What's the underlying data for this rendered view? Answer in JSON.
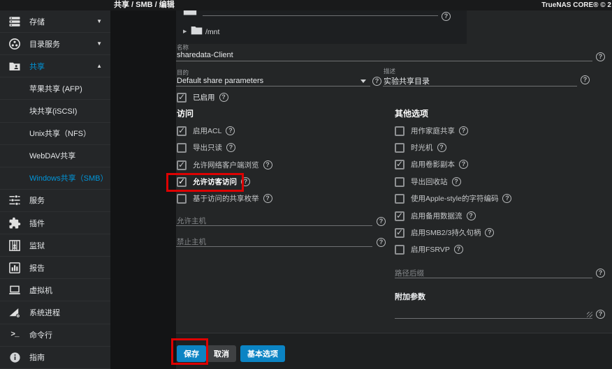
{
  "topbar": {
    "breadcrumb": "共享 / SMB / 编辑",
    "brand": "TrueNAS CORE® © 2"
  },
  "icons": {
    "check": "✓",
    "help": "?",
    "chevron_down": "▼",
    "chevron_up": "▲",
    "tree_collapsed": "▶"
  },
  "sidebar": {
    "items": [
      {
        "label": "存储",
        "icon": "storage-icon",
        "expander": "down"
      },
      {
        "label": "目录服务",
        "icon": "directory-services-icon",
        "expander": "down"
      },
      {
        "label": "共享",
        "icon": "folder-shared-icon",
        "expander": "up",
        "active": true
      },
      {
        "label": "苹果共享 (AFP)",
        "sub": true
      },
      {
        "label": "块共享(iSCSI)",
        "sub": true
      },
      {
        "label": "Unix共享（NFS）",
        "sub": true
      },
      {
        "label": "WebDAV共享",
        "sub": true
      },
      {
        "label": "Windows共享（SMB）",
        "sub": true,
        "active": true
      },
      {
        "label": "服务",
        "icon": "services-icon"
      },
      {
        "label": "插件",
        "icon": "plugins-icon"
      },
      {
        "label": "监狱",
        "icon": "jails-icon"
      },
      {
        "label": "报告",
        "icon": "reporting-icon"
      },
      {
        "label": "虚拟机",
        "icon": "vm-icon"
      },
      {
        "label": "系统进程",
        "icon": "system-processes-icon"
      },
      {
        "label": "命令行",
        "icon": "shell-icon",
        "shell_glyph": ">_"
      },
      {
        "label": "指南",
        "icon": "guide-icon",
        "guide_glyph": "i"
      }
    ]
  },
  "form": {
    "tree": {
      "root": "/mnt"
    },
    "name": {
      "label": "名称",
      "value": "sharedata-Client"
    },
    "purpose": {
      "label": "目的",
      "value": "Default share parameters"
    },
    "description": {
      "label": "描述",
      "value": "实验共享目录"
    },
    "enabled": {
      "label": "已启用",
      "checked": true
    },
    "access": {
      "title": "访问",
      "checkboxes": [
        {
          "label": "启用ACL",
          "checked": true
        },
        {
          "label": "导出只读",
          "checked": false
        },
        {
          "label": "允许网络客户端浏览",
          "checked": true
        },
        {
          "label": "允许访客访问",
          "checked": true,
          "highlighted": true
        },
        {
          "label": "基于访问的共享枚举",
          "checked": false
        }
      ],
      "allow_hosts": {
        "placeholder": "允许主机"
      },
      "deny_hosts": {
        "placeholder": "禁止主机"
      }
    },
    "other": {
      "title": "其他选项",
      "checkboxes": [
        {
          "label": "用作家庭共享",
          "checked": false
        },
        {
          "label": "时光机",
          "checked": false
        },
        {
          "label": "启用卷影副本",
          "checked": true
        },
        {
          "label": "导出回收站",
          "checked": false
        },
        {
          "label": "使用Apple-style的字符编码",
          "checked": false
        },
        {
          "label": "启用备用数据流",
          "checked": true
        },
        {
          "label": "启用SMB2/3持久句柄",
          "checked": true
        },
        {
          "label": "启用FSRVP",
          "checked": false
        }
      ],
      "path_suffix": {
        "placeholder": "路径后缀"
      },
      "extra_params": {
        "label": "附加参数"
      }
    },
    "buttons": {
      "save": "保存",
      "cancel": "取消",
      "basic": "基本选项"
    }
  },
  "colors": {
    "accent": "#0095d9",
    "button_blue": "#0b84c4",
    "highlight_red": "#dd0202"
  }
}
